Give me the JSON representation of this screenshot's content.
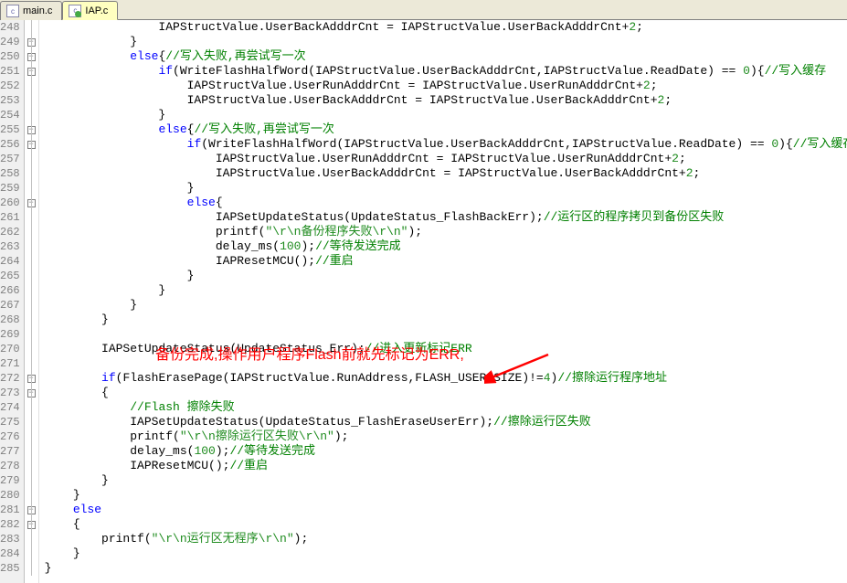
{
  "tabs": [
    {
      "name": "main.c",
      "active": false
    },
    {
      "name": "IAP.c",
      "active": true
    }
  ],
  "line_start": 248,
  "line_end": 285,
  "fold_markers": {
    "249": "box",
    "250": "box",
    "251": "box",
    "255": "box",
    "256": "box",
    "260": "box",
    "272": "box",
    "273": "box",
    "281": "box",
    "282": "box"
  },
  "annotation_text": "备份完成,操作用户程序Flash前就先标记为ERR,",
  "code": [
    {
      "i": "                ",
      "t": [
        [
          "",
          "IAPStructValue.UserBackAdddrCnt = IAPStructValue.UserBackAdddrCnt+"
        ],
        [
          "n",
          "2"
        ],
        [
          "",
          ";"
        ]
      ]
    },
    {
      "i": "            ",
      "t": [
        [
          "",
          "}"
        ]
      ]
    },
    {
      "i": "            ",
      "t": [
        [
          "k",
          "else"
        ],
        [
          "",
          "{"
        ],
        [
          "c",
          "//写入失败,再尝试写一次"
        ]
      ]
    },
    {
      "i": "                ",
      "t": [
        [
          "k",
          "if"
        ],
        [
          "",
          "(WriteFlashHalfWord(IAPStructValue.UserBackAdddrCnt,IAPStructValue.ReadDate) == "
        ],
        [
          "n",
          "0"
        ],
        [
          "",
          "){"
        ],
        [
          "c",
          "//写入缓存"
        ]
      ]
    },
    {
      "i": "                    ",
      "t": [
        [
          "",
          "IAPStructValue.UserRunAdddrCnt = IAPStructValue.UserRunAdddrCnt+"
        ],
        [
          "n",
          "2"
        ],
        [
          "",
          ";"
        ]
      ]
    },
    {
      "i": "                    ",
      "t": [
        [
          "",
          "IAPStructValue.UserBackAdddrCnt = IAPStructValue.UserBackAdddrCnt+"
        ],
        [
          "n",
          "2"
        ],
        [
          "",
          ";"
        ]
      ]
    },
    {
      "i": "                ",
      "t": [
        [
          "",
          "}"
        ]
      ]
    },
    {
      "i": "                ",
      "t": [
        [
          "k",
          "else"
        ],
        [
          "",
          "{"
        ],
        [
          "c",
          "//写入失败,再尝试写一次"
        ]
      ]
    },
    {
      "i": "                    ",
      "t": [
        [
          "k",
          "if"
        ],
        [
          "",
          "(WriteFlashHalfWord(IAPStructValue.UserBackAdddrCnt,IAPStructValue.ReadDate) == "
        ],
        [
          "n",
          "0"
        ],
        [
          "",
          "){"
        ],
        [
          "c",
          "//写入缓存"
        ]
      ]
    },
    {
      "i": "                        ",
      "t": [
        [
          "",
          "IAPStructValue.UserRunAdddrCnt = IAPStructValue.UserRunAdddrCnt+"
        ],
        [
          "n",
          "2"
        ],
        [
          "",
          ";"
        ]
      ]
    },
    {
      "i": "                        ",
      "t": [
        [
          "",
          "IAPStructValue.UserBackAdddrCnt = IAPStructValue.UserBackAdddrCnt+"
        ],
        [
          "n",
          "2"
        ],
        [
          "",
          ";"
        ]
      ]
    },
    {
      "i": "                    ",
      "t": [
        [
          "",
          "}"
        ]
      ]
    },
    {
      "i": "                    ",
      "t": [
        [
          "k",
          "else"
        ],
        [
          "",
          "{"
        ]
      ]
    },
    {
      "i": "                        ",
      "t": [
        [
          "",
          "IAPSetUpdateStatus(UpdateStatus_FlashBackErr);"
        ],
        [
          "c",
          "//运行区的程序拷贝到备份区失败"
        ]
      ]
    },
    {
      "i": "                        ",
      "t": [
        [
          "",
          "printf("
        ],
        [
          "s",
          "\"\\r\\n备份程序失败\\r\\n\""
        ],
        [
          "",
          ");"
        ]
      ]
    },
    {
      "i": "                        ",
      "t": [
        [
          "",
          "delay_ms("
        ],
        [
          "n",
          "100"
        ],
        [
          "",
          ");"
        ],
        [
          "c",
          "//等待发送完成"
        ]
      ]
    },
    {
      "i": "                        ",
      "t": [
        [
          "",
          "IAPResetMCU();"
        ],
        [
          "c",
          "//重启"
        ]
      ]
    },
    {
      "i": "                    ",
      "t": [
        [
          "",
          "}"
        ]
      ]
    },
    {
      "i": "                ",
      "t": [
        [
          "",
          "}"
        ]
      ]
    },
    {
      "i": "            ",
      "t": [
        [
          "",
          "}"
        ]
      ]
    },
    {
      "i": "        ",
      "t": [
        [
          "",
          "}"
        ]
      ]
    },
    {
      "i": "",
      "t": [
        [
          "",
          ""
        ]
      ]
    },
    {
      "i": "        ",
      "t": [
        [
          "",
          "IAPSetUpdateStatus(UpdateStatus_Err);"
        ],
        [
          "c",
          "//进入更新标记ERR"
        ]
      ]
    },
    {
      "i": "",
      "t": [
        [
          "",
          ""
        ]
      ]
    },
    {
      "i": "        ",
      "t": [
        [
          "k",
          "if"
        ],
        [
          "",
          "(FlashErasePage(IAPStructValue.RunAddress,FLASH_USER_SIZE)!="
        ],
        [
          "n",
          "4"
        ],
        [
          "",
          ")"
        ],
        [
          "c",
          "//擦除运行程序地址"
        ]
      ]
    },
    {
      "i": "        ",
      "t": [
        [
          "",
          "{"
        ]
      ]
    },
    {
      "i": "            ",
      "t": [
        [
          "c",
          "//Flash 擦除失败"
        ]
      ]
    },
    {
      "i": "            ",
      "t": [
        [
          "",
          "IAPSetUpdateStatus(UpdateStatus_FlashEraseUserErr);"
        ],
        [
          "c",
          "//擦除运行区失败"
        ]
      ]
    },
    {
      "i": "            ",
      "t": [
        [
          "",
          "printf("
        ],
        [
          "s",
          "\"\\r\\n擦除运行区失败\\r\\n\""
        ],
        [
          "",
          ");"
        ]
      ]
    },
    {
      "i": "            ",
      "t": [
        [
          "",
          "delay_ms("
        ],
        [
          "n",
          "100"
        ],
        [
          "",
          ");"
        ],
        [
          "c",
          "//等待发送完成"
        ]
      ]
    },
    {
      "i": "            ",
      "t": [
        [
          "",
          "IAPResetMCU();"
        ],
        [
          "c",
          "//重启"
        ]
      ]
    },
    {
      "i": "        ",
      "t": [
        [
          "",
          "}"
        ]
      ]
    },
    {
      "i": "    ",
      "t": [
        [
          "",
          "}"
        ]
      ]
    },
    {
      "i": "    ",
      "t": [
        [
          "k",
          "else"
        ]
      ]
    },
    {
      "i": "    ",
      "t": [
        [
          "",
          "{"
        ]
      ]
    },
    {
      "i": "        ",
      "t": [
        [
          "",
          "printf("
        ],
        [
          "s",
          "\"\\r\\n运行区无程序\\r\\n\""
        ],
        [
          "",
          ");"
        ]
      ]
    },
    {
      "i": "    ",
      "t": [
        [
          "",
          "}"
        ]
      ]
    },
    {
      "i": "",
      "t": [
        [
          "",
          "}"
        ]
      ]
    }
  ]
}
